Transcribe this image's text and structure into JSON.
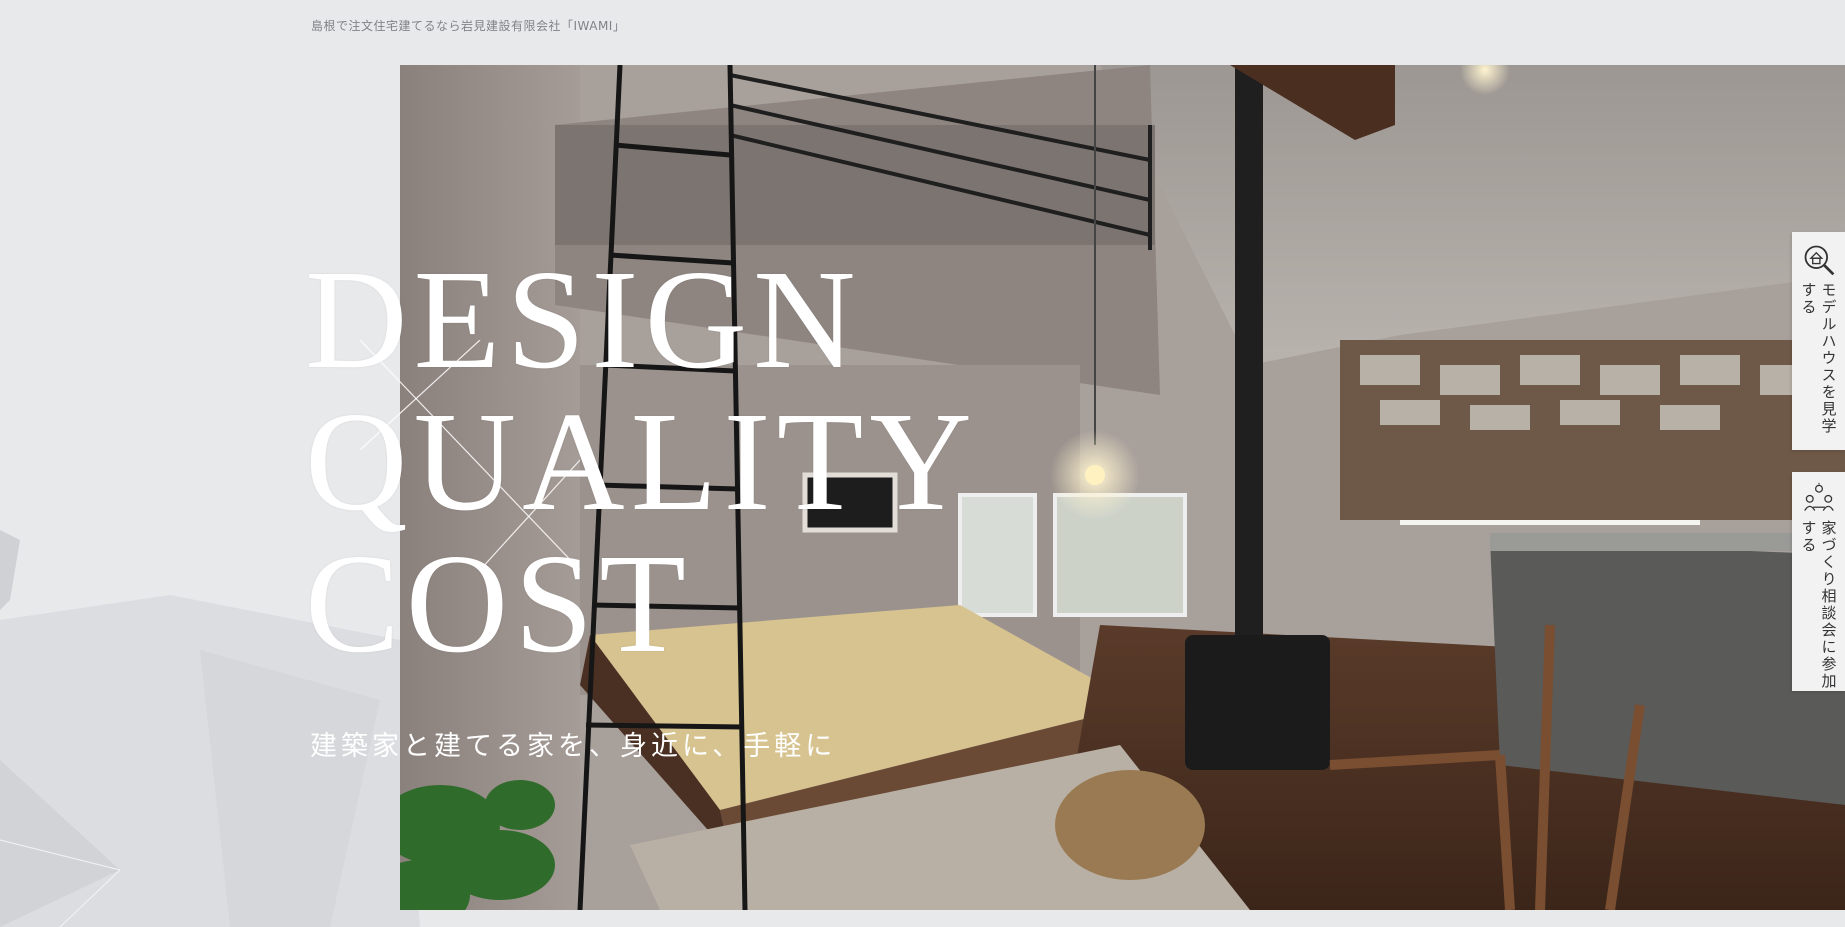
{
  "site": {
    "tagline": "島根で注文住宅建てるなら岩見建設有限会社「IWAMI」"
  },
  "hero": {
    "headline": [
      "DESIGN",
      "QUALITY",
      "COST"
    ],
    "subcopy": "建築家と建てる家を、身近に、手軽に"
  },
  "side_tabs": [
    {
      "label": "モデルハウスを見学する",
      "icon": "house-search-icon"
    },
    {
      "label": "家づくり相談会に参加する",
      "icon": "consultation-icon"
    }
  ],
  "colors": {
    "page_bg": "#e8e9eb",
    "tab_bg": "#f2f2f2",
    "headline": "#ffffff"
  }
}
